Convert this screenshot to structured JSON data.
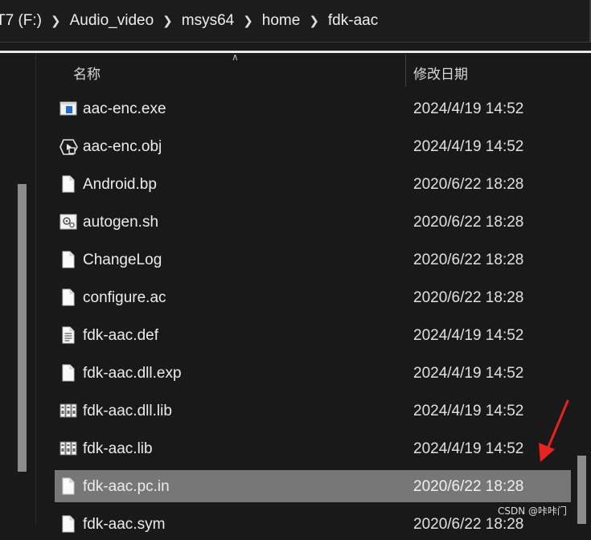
{
  "breadcrumb": {
    "items": [
      "T7 (F:)",
      "Audio_video",
      "msys64",
      "home",
      "fdk-aac"
    ]
  },
  "columns": {
    "name": "名称",
    "modified": "修改日期"
  },
  "files": [
    {
      "name": "aac-enc.exe",
      "date": "2024/4/19 14:52",
      "icon": "exe-icon"
    },
    {
      "name": "aac-enc.obj",
      "date": "2024/4/19 14:52",
      "icon": "obj-file-icon"
    },
    {
      "name": "Android.bp",
      "date": "2020/6/22 18:28",
      "icon": "file-icon"
    },
    {
      "name": "autogen.sh",
      "date": "2020/6/22 18:28",
      "icon": "script-file-icon"
    },
    {
      "name": "ChangeLog",
      "date": "2020/6/22 18:28",
      "icon": "file-icon"
    },
    {
      "name": "configure.ac",
      "date": "2020/6/22 18:28",
      "icon": "file-icon"
    },
    {
      "name": "fdk-aac.def",
      "date": "2024/4/19 14:52",
      "icon": "text-file-icon"
    },
    {
      "name": "fdk-aac.dll.exp",
      "date": "2024/4/19 14:52",
      "icon": "file-icon"
    },
    {
      "name": "fdk-aac.dll.lib",
      "date": "2024/4/19 14:52",
      "icon": "library-icon"
    },
    {
      "name": "fdk-aac.lib",
      "date": "2024/4/19 14:52",
      "icon": "library-icon"
    },
    {
      "name": "fdk-aac.pc.in",
      "date": "2020/6/22 18:28",
      "icon": "file-icon",
      "selected": true
    },
    {
      "name": "fdk-aac.sym",
      "date": "2020/6/22 18:28",
      "icon": "file-icon"
    }
  ],
  "watermark": "CSDN @咔咔门",
  "colors": {
    "background": "#191919",
    "selected_row": "#777777",
    "annotation_arrow": "#e8231f"
  }
}
